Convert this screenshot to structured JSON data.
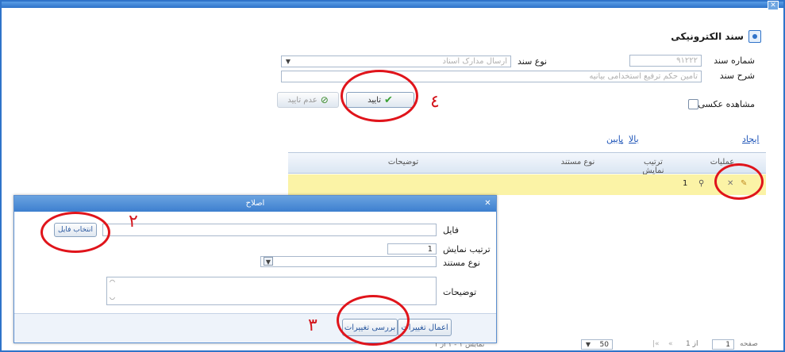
{
  "window": {
    "close": "✕"
  },
  "header": {
    "title": "سند الکترونیکی",
    "icon": "document-icon"
  },
  "form": {
    "doc_number_label": "شماره سند",
    "doc_number_value": "۹۱۲۲۲",
    "doc_type_label": "نوع سند",
    "doc_type_value": "ارسال مدارک اسناد",
    "doc_desc_label": "شرح سند",
    "doc_desc_value": "تامین حکم ترفیع استخدامی بیانیه",
    "reverse_label": "مشاهده عکسی"
  },
  "buttons": {
    "confirm": "تایید",
    "cancel_confirm": "عدم تایید"
  },
  "links": {
    "new": "ایجاد",
    "up": "بالا",
    "down": "پایین"
  },
  "grid": {
    "headers": [
      "عملیات",
      "ترتیب نمایش",
      "نوع مستند",
      "توضیحات"
    ],
    "row": {
      "order": "1"
    }
  },
  "modal": {
    "title": "اصلاح",
    "close": "✕",
    "file_label": "فایل",
    "select_file_button": "انتخاب فایل",
    "order_label": "ترتیب نمایش",
    "order_value": "1",
    "doc_type_label": "نوع مستند",
    "desc_label": "توضیحات",
    "review_button": "بررسی تغییرات",
    "apply_button": "اعمال تغییرات"
  },
  "pager": {
    "page_label": "صفحه",
    "page_value": "1",
    "of_label": "از 1",
    "page_size": "50",
    "showing": "نمایش ۱ - ۱ از ۱"
  },
  "annotations": {
    "n2": "٢",
    "n3": "٣",
    "n4": "٤"
  },
  "colors": {
    "accent": "#2f73c9",
    "row_highlight": "#fbf3a6",
    "annotation": "#e0141b"
  }
}
